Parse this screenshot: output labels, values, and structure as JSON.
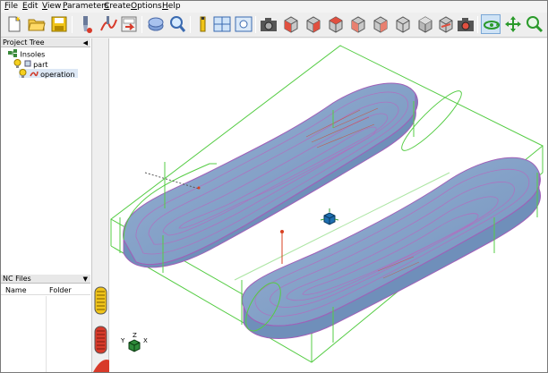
{
  "menu": [
    "File",
    "Edit",
    "View",
    "Parameters",
    "Create",
    "Options",
    "Help"
  ],
  "toolbar": {
    "icons": [
      "new-file-icon",
      "open-folder-icon",
      "save-icon",
      "tool-icon",
      "toolpath-icon",
      "export-icon",
      "stock-icon",
      "find-icon",
      "info-icon",
      "layout-icon",
      "window-icon",
      "camera-icon",
      "view-cube-icon",
      "view-cube-front-icon",
      "view-cube-left-icon",
      "view-cube-top-icon",
      "view-cube-right-icon",
      "view-cube-back-icon",
      "view-cube-iso-icon",
      "snapshot-icon",
      "rotate-icon",
      "pan-icon",
      "zoom-icon"
    ],
    "active": "rotate-icon"
  },
  "project_tree": {
    "title": "Project Tree",
    "items": [
      {
        "label": "Insoles",
        "level": 0,
        "icon": "project-icon"
      },
      {
        "label": "part",
        "level": 1,
        "icon": "lightbulb-icon"
      },
      {
        "label": "operation",
        "level": 1,
        "icon": "operation-icon",
        "selected": true
      }
    ]
  },
  "nc_files": {
    "title": "NC Files",
    "columns": [
      "Name",
      "Folder"
    ]
  },
  "viewport": {
    "axis_labels": {
      "x": "X",
      "y": "Y",
      "z": "Z"
    },
    "colors": {
      "surface": "#7fa0c8",
      "contour": "#a060b8",
      "bounds": "#55cc44",
      "toolpath": "#d84020"
    }
  }
}
